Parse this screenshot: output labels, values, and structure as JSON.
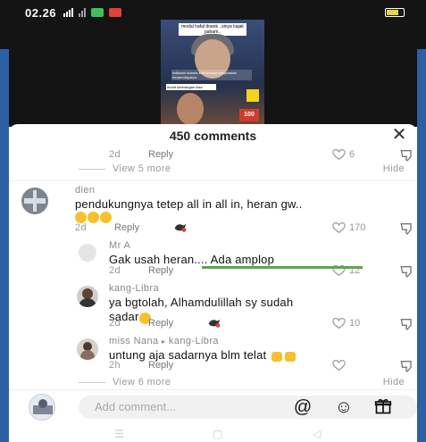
{
  "status_bar": {
    "time": "02.26"
  },
  "video": {
    "caption_top": "modal hafal doank ..sinya kajak paham..",
    "caption_mid": "indikator sukses kita kecaka masyarakat berpendapatan",
    "caption_low": "murid keterangan bisa",
    "badge": "100"
  },
  "header": {
    "title": "450 comments",
    "close_symbol": "✕"
  },
  "thread_top": {
    "time": "2d",
    "reply_label": "Reply",
    "likes": "6",
    "view_more": "View 5 more",
    "hide": "Hide"
  },
  "comments": [
    {
      "name": "dien",
      "text": "pendukungnya tetep all in all in, heran gw..",
      "time": "2d",
      "reply_label": "Reply",
      "likes": "170"
    },
    {
      "name": "Mr A",
      "text": "Gak usah heran.... Ada amplop",
      "time": "2d",
      "reply_label": "Reply",
      "likes": "12"
    },
    {
      "name": "kang-Libra",
      "text_line1": "ya bgtolah, Alhamdulillah sy sudah",
      "text_line2": "sadar",
      "time": "2d",
      "reply_label": "Reply",
      "likes": "10"
    },
    {
      "name": "miss Nana",
      "reply_to": "kang-Libra",
      "text": "untung aja sadarnya blm telat",
      "time": "2h",
      "reply_label": "Reply"
    }
  ],
  "thread_bottom": {
    "view_more": "View 6 more",
    "hide": "Hide"
  },
  "composer": {
    "placeholder": "Add comment..."
  },
  "colors": {
    "accent_green": "#5aa84a",
    "sheet_bg": "#ffffff",
    "top_bg": "#141414"
  }
}
